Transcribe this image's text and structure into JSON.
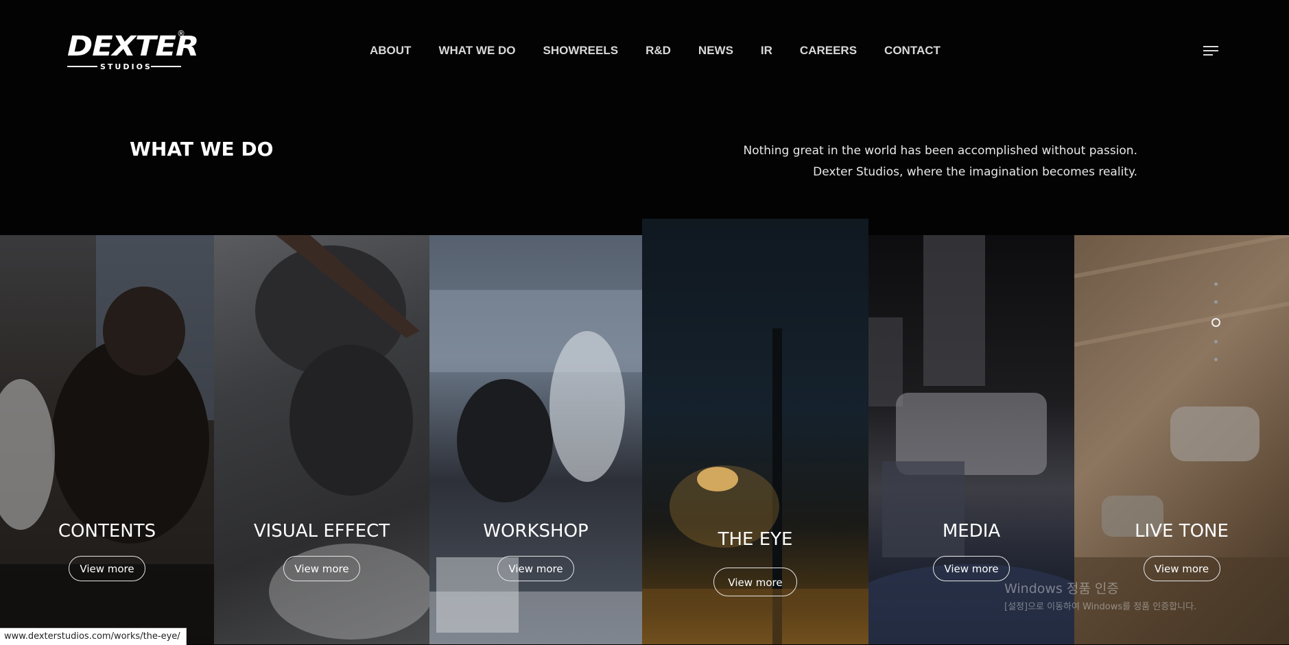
{
  "brand": {
    "logo_text": "DEXTER",
    "logo_sub": "STUDIOS",
    "logo_mark": "®"
  },
  "nav": {
    "items": [
      "ABOUT",
      "WHAT WE DO",
      "SHOWREELS",
      "R&D",
      "NEWS",
      "IR",
      "CAREERS",
      "CONTACT"
    ]
  },
  "menu_icon": "hamburger-menu-icon",
  "section": {
    "title": "WHAT WE DO",
    "tagline_line1": "Nothing great in the world has been accomplished without passion.",
    "tagline_line2": "Dexter Studios, where the imagination becomes reality."
  },
  "panels": [
    {
      "title": "CONTENTS",
      "button": "View more"
    },
    {
      "title": "VISUAL EFFECT",
      "button": "View more"
    },
    {
      "title": "WORKSHOP",
      "button": "View more"
    },
    {
      "title": "THE EYE",
      "button": "View more"
    },
    {
      "title": "MEDIA",
      "button": "View more"
    },
    {
      "title": "LIVE TONE",
      "button": "View more"
    }
  ],
  "pager": {
    "count": 5,
    "active_index": 2
  },
  "status_url": "www.dexterstudios.com/works/the-eye/",
  "os_watermark": {
    "line1": "Windows 정품 인증",
    "line2": "[설정]으로 이동하여 Windows를 정품 인증합니다."
  }
}
